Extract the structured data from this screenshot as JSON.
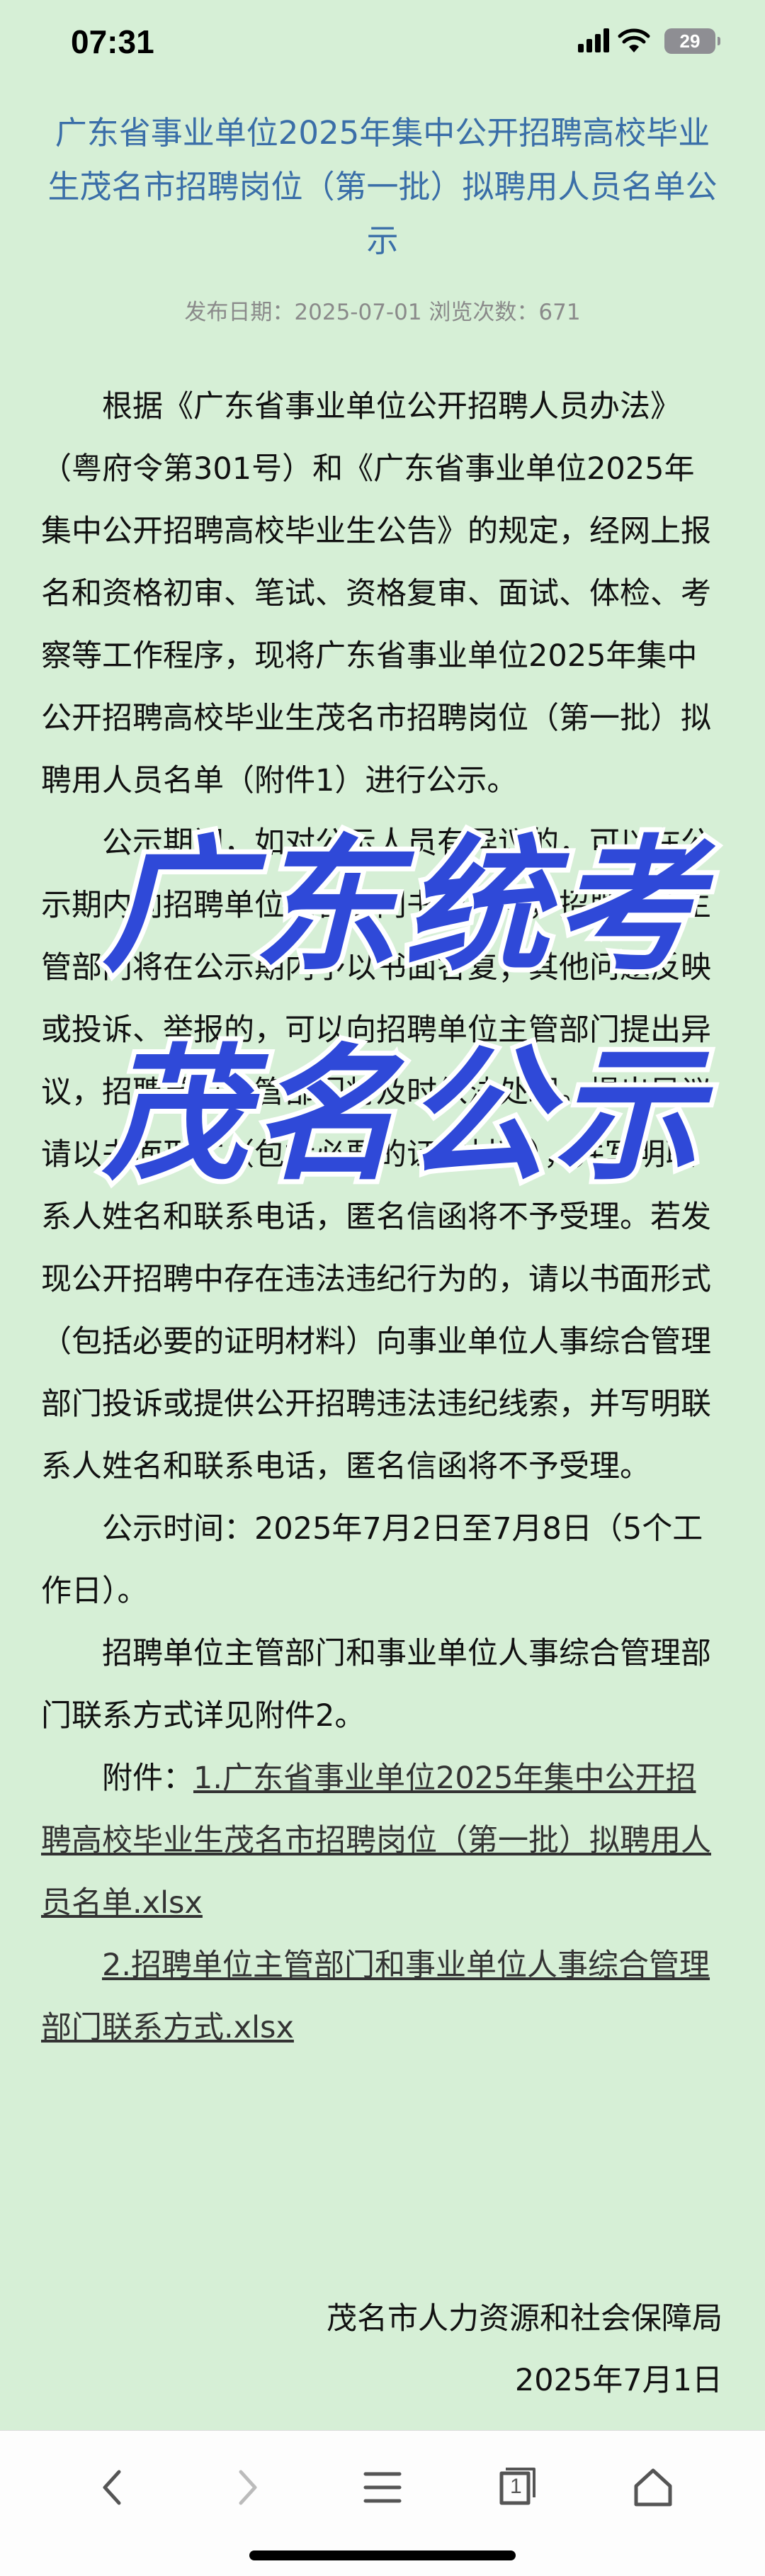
{
  "status_bar": {
    "time": "07:31",
    "battery": "29",
    "icons": [
      "signal-icon",
      "wifi-icon",
      "battery-icon"
    ]
  },
  "article": {
    "title": "广东省事业单位2025年集中公开招聘高校毕业生茂名市招聘岗位（第一批）拟聘用人员名单公示",
    "meta": "发布日期：2025-07-01   浏览次数：671",
    "para1": "根据《广东省事业单位公开招聘人员办法》（粤府令第301号）和《广东省事业单位2025年集中公开招聘高校毕业生公告》的规定，经网上报名和资格初审、笔试、资格复审、面试、体检、考察等工作程序，现将广东省事业单位2025年集中公开招聘高校毕业生茂名市招聘岗位（第一批）拟聘用人员名单（附件1）进行公示。",
    "para2": "公示期间，如对公示人员有异议的，可以在公示期内向招聘单位主管部门书面申辩，招聘单位主管部门将在公示期内予以书面答复；其他问题反映或投诉、举报的，可以向招聘单位主管部门提出异议，招聘单位主管部门将及时依法处理。提出异议请以书面形式（包括必要的证明材料），并写明联系人姓名和联系电话，匿名信函将不予受理。若发现公开招聘中存在违法违纪行为的，请以书面形式（包括必要的证明材料）向事业单位人事综合管理部门投诉或提供公开招聘违法违纪线索，并写明联系人姓名和联系电话，匿名信函将不予受理。",
    "para3": "公示时间：2025年7月2日至7月8日（5个工作日）。",
    "para4": "招聘单位主管部门和事业单位人事综合管理部门联系方式详见附件2。",
    "attachments_label": "附件：",
    "attachment1": "1.广东省事业单位2025年集中公开招聘高校毕业生茂名市招聘岗位（第一批）拟聘用人员名单.xlsx",
    "attachment2": "2.招聘单位主管部门和事业单位人事综合管理部门联系方式.xlsx",
    "signature_org": "茂名市人力资源和社会保障局",
    "signature_date": "2025年7月1日"
  },
  "overlay": {
    "line1": "广东统考",
    "line2": "茂名公示",
    "color": "#2f49d8"
  },
  "bottom_nav": {
    "items": [
      "back-icon",
      "forward-icon",
      "menu-icon",
      "tabs-icon",
      "home-icon"
    ],
    "tabs_count": "1"
  },
  "colors": {
    "background": "#d6efd6",
    "title": "#3a6ea8",
    "meta": "#8a8a8a"
  }
}
